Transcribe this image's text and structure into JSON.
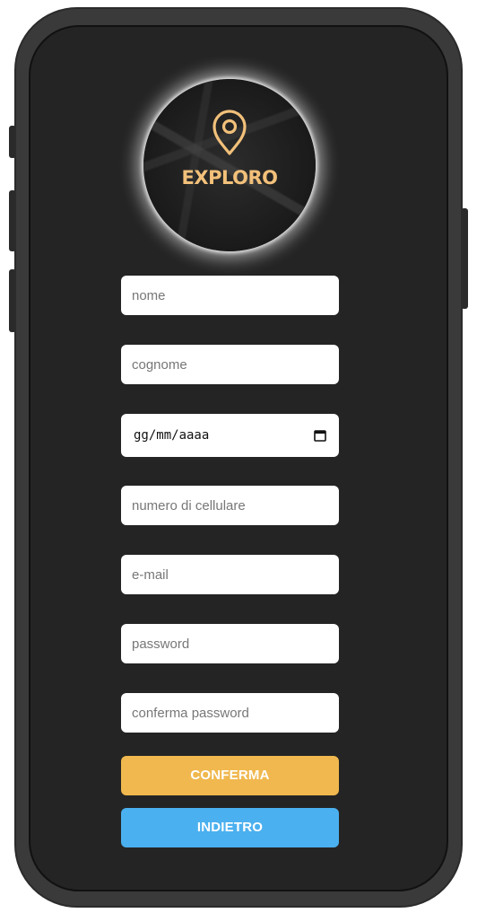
{
  "brand": {
    "name": "EXPLORO",
    "accent_color": "#f2c07a",
    "icon": "map-pin-icon"
  },
  "form": {
    "nome_placeholder": "nome",
    "cognome_placeholder": "cognome",
    "date_value": "gg/mm/aaaa",
    "phone_placeholder": "numero di cellulare",
    "email_placeholder": "e-mail",
    "password_placeholder": "password",
    "confirm_password_placeholder": "conferma password"
  },
  "buttons": {
    "confirm_label": "CONFERMA",
    "back_label": "INDIETRO",
    "confirm_color": "#f0b84e",
    "back_color": "#4bb0ef"
  }
}
